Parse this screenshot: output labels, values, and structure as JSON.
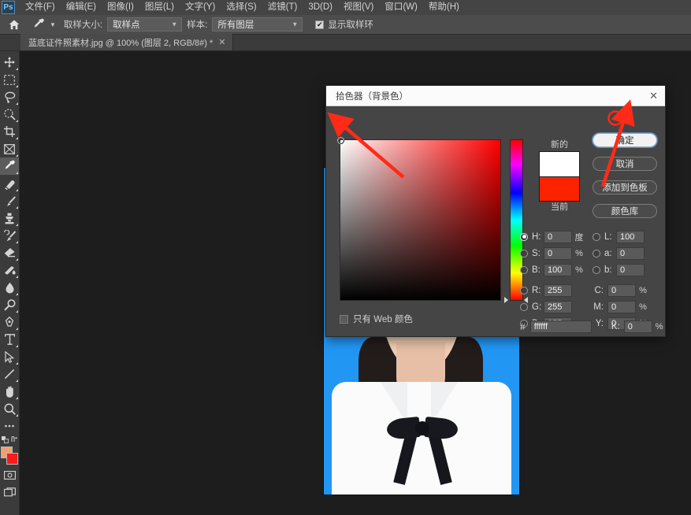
{
  "app": {
    "logo": "Ps",
    "menu": [
      {
        "label": "文件(F)"
      },
      {
        "label": "编辑(E)"
      },
      {
        "label": "图像(I)"
      },
      {
        "label": "图层(L)"
      },
      {
        "label": "文字(Y)"
      },
      {
        "label": "选择(S)"
      },
      {
        "label": "滤镜(T)"
      },
      {
        "label": "3D(D)"
      },
      {
        "label": "视图(V)"
      },
      {
        "label": "窗口(W)"
      },
      {
        "label": "帮助(H)"
      }
    ]
  },
  "options_bar": {
    "home_icon": "home-icon",
    "tool_icon": "eyedropper-icon",
    "sample_size_label": "取样大小:",
    "sample_size_value": "取样点",
    "sample_label": "样本:",
    "sample_value": "所有图层",
    "show_ring_label": "显示取样环",
    "show_ring_checked": true,
    "check_glyph": "✔"
  },
  "document_tab": {
    "title": "蓝底证件照素材.jpg @ 100% (图层 2, RGB/8#) *",
    "close_glyph": "✕"
  },
  "toolbar": {
    "tools": [
      {
        "name": "move-tool"
      },
      {
        "name": "rectangular-marquee-tool"
      },
      {
        "name": "lasso-tool"
      },
      {
        "name": "quick-selection-tool"
      },
      {
        "name": "crop-tool"
      },
      {
        "name": "frame-tool"
      },
      {
        "name": "eyedropper-tool",
        "active": true
      },
      {
        "name": "spot-healing-brush-tool"
      },
      {
        "name": "brush-tool"
      },
      {
        "name": "clone-stamp-tool"
      },
      {
        "name": "history-brush-tool"
      },
      {
        "name": "eraser-tool"
      },
      {
        "name": "gradient-tool"
      },
      {
        "name": "blur-tool"
      },
      {
        "name": "dodge-tool"
      },
      {
        "name": "pen-tool"
      },
      {
        "name": "type-tool"
      },
      {
        "name": "path-selection-tool"
      },
      {
        "name": "line-tool"
      },
      {
        "name": "hand-tool"
      },
      {
        "name": "zoom-tool"
      },
      {
        "name": "edit-toolbar-tool"
      }
    ],
    "foreground_color": "#f0a070",
    "background_color": "#ff1a1a",
    "quick_mask_icon": "quick-mask-icon",
    "screen_mode_icon": "screen-mode-icon"
  },
  "canvas": {
    "photo_background_color": "#2196f3",
    "shirt_color": "#fbfbfb",
    "bowtie_color": "#17191f"
  },
  "dialog": {
    "title": "拾色器（背景色）",
    "close_glyph": "✕",
    "buttons": [
      {
        "label": "确定",
        "primary": true
      },
      {
        "label": "取消",
        "primary": false
      },
      {
        "label": "添加到色板",
        "primary": false
      },
      {
        "label": "颜色库",
        "primary": false
      }
    ],
    "preview": {
      "new_label": "新的",
      "current_label": "当前",
      "new_color": "#ffffff",
      "current_color": "#fb2200"
    },
    "web_only": {
      "label": "只有 Web 颜色",
      "checked": false
    },
    "field": {
      "hue_color": "#ff0000",
      "marker_x_pct": 0,
      "marker_y_pct": 0,
      "hue_marker_pct": 100
    },
    "hsb": [
      {
        "key": "H",
        "label": "H:",
        "value": "0",
        "unit": "度",
        "selected": true
      },
      {
        "key": "S",
        "label": "S:",
        "value": "0",
        "unit": "%",
        "selected": false
      },
      {
        "key": "B",
        "label": "B:",
        "value": "100",
        "unit": "%",
        "selected": false
      }
    ],
    "rgb": [
      {
        "key": "R",
        "label": "R:",
        "value": "255",
        "unit": "",
        "selected": false
      },
      {
        "key": "G",
        "label": "G:",
        "value": "255",
        "unit": "",
        "selected": false
      },
      {
        "key": "B",
        "label": "B:",
        "value": "255",
        "unit": "",
        "selected": false
      }
    ],
    "lab": [
      {
        "key": "L",
        "label": "L:",
        "value": "100",
        "unit": "",
        "selected": false
      },
      {
        "key": "a",
        "label": "a:",
        "value": "0",
        "unit": "",
        "selected": false
      },
      {
        "key": "b",
        "label": "b:",
        "value": "0",
        "unit": "",
        "selected": false
      }
    ],
    "cmyk": [
      {
        "key": "C",
        "label": "C:",
        "value": "0",
        "unit": "%"
      },
      {
        "key": "M",
        "label": "M:",
        "value": "0",
        "unit": "%"
      },
      {
        "key": "Y",
        "label": "Y:",
        "value": "0",
        "unit": "%"
      },
      {
        "key": "K",
        "label": "K:",
        "value": "0",
        "unit": "%"
      }
    ],
    "hex": {
      "hash": "#",
      "value": "ffffff"
    }
  },
  "annotations": {
    "arrow_color": "#ff2a17",
    "arrow_to_field_marker": "arrow-pointing-to-color-field-marker",
    "arrow_to_ok_button": "arrow-pointing-to-ok-button",
    "circle_on_ok_button": "circle-highlight-on-ok-button"
  }
}
